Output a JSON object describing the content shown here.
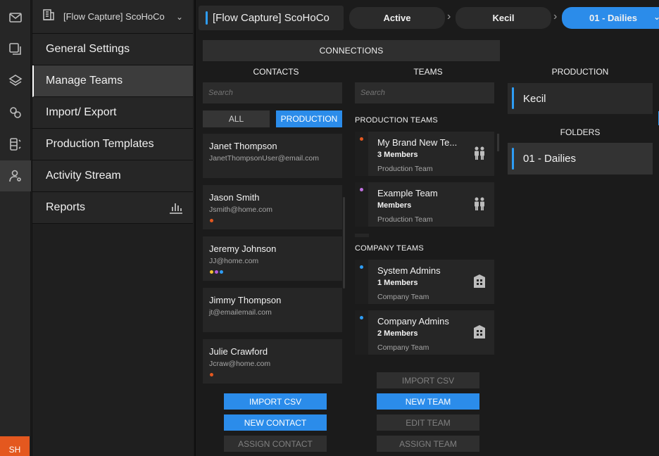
{
  "rail": {
    "icons": [
      "mail-icon",
      "copy-icon",
      "layers-icon",
      "link-icon",
      "columns-icon",
      "user-settings-icon"
    ],
    "avatar_initials": "SH",
    "avatar_color": "#e4581f"
  },
  "sidebar": {
    "org_name": "[Flow Capture] ScoHoCo",
    "items": [
      {
        "label": "General Settings"
      },
      {
        "label": "Manage Teams"
      },
      {
        "label": "Import/ Export"
      },
      {
        "label": "Production Templates"
      },
      {
        "label": "Activity Stream"
      },
      {
        "label": "Reports"
      }
    ]
  },
  "header": {
    "context_title": "[Flow Capture] ScoHoCo",
    "breadcrumbs": [
      "Active",
      "Kecil",
      "01 - Dailies"
    ],
    "accent": "#2b8cea"
  },
  "connections": {
    "label": "CONNECTIONS"
  },
  "contacts": {
    "heading": "CONTACTS",
    "search_placeholder": "Search",
    "filter_all": "ALL",
    "filter_production": "PRODUCTION",
    "items": [
      {
        "name": "Janet Thompson",
        "email": "JanetThompsonUser@email.com",
        "dots": []
      },
      {
        "name": "Jason Smith",
        "email": "Jsmith@home.com",
        "dots": [
          "#e4581f"
        ]
      },
      {
        "name": "Jeremy Johnson",
        "email": "JJ@home.com",
        "dots": [
          "#f2c230",
          "#b05bd8",
          "#2e9df5"
        ]
      },
      {
        "name": "Jimmy Thompson",
        "email": "jt@emailemail.com",
        "dots": []
      },
      {
        "name": "Julie Crawford",
        "email": "Jcraw@home.com",
        "dots": [
          "#e4581f"
        ]
      }
    ],
    "buttons": {
      "import_csv": "IMPORT CSV",
      "new_contact": "NEW CONTACT",
      "assign_contact": "ASSIGN CONTACT"
    }
  },
  "teams": {
    "heading": "TEAMS",
    "search_placeholder": "Search",
    "production_label": "PRODUCTION TEAMS",
    "company_label": "COMPANY TEAMS",
    "production_teams": [
      {
        "name": "My Brand New Te...",
        "members": "3 Members",
        "type": "Production Team",
        "dot": "#e4581f"
      },
      {
        "name": "Example Team",
        "members": "Members",
        "type": "Production Team",
        "dot": "#c070e0"
      }
    ],
    "company_teams": [
      {
        "name": "System Admins",
        "members": "1 Members",
        "type": "Company Team",
        "dot": "#2e9df5"
      },
      {
        "name": "Company Admins",
        "members": "2 Members",
        "type": "Company Team",
        "dot": "#2e9df5"
      }
    ],
    "buttons": {
      "import_csv": "IMPORT CSV",
      "new_team": "NEW TEAM",
      "edit_team": "EDIT TEAM",
      "assign_team": "ASSIGN TEAM"
    }
  },
  "production": {
    "heading": "PRODUCTION",
    "name": "Kecil",
    "folders_label": "FOLDERS",
    "folder": "01 - Dailies"
  }
}
